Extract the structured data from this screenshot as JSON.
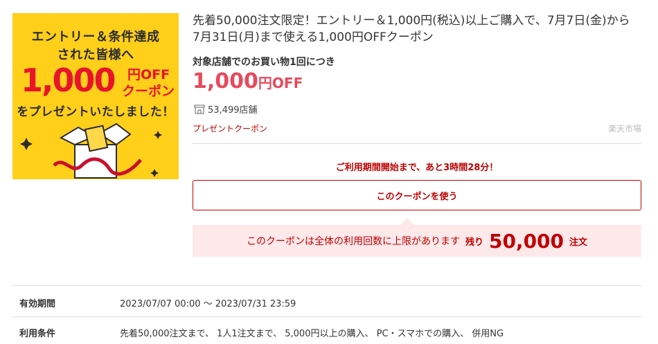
{
  "banner": {
    "line1": "エントリー＆条件達成",
    "line2": "された皆様へ",
    "amount": "1,000",
    "off_line1": "円OFF",
    "off_line2": "クーポン",
    "line5": "をプレゼントいたしました！"
  },
  "coupon": {
    "title": "先着50,000注文限定！エントリー＆1,000円(税込)以上ご購入で、7月7日(金)から7月31日(月)まで使える1,000円OFFクーポン",
    "subtitle": "対象店舗でのお買い物1回につき",
    "discount_value": "1,000",
    "discount_unit": "円OFF",
    "store_icon": "store-icon",
    "store_count": "53,499店舗",
    "coupon_type": "プレゼントクーポン",
    "provider": "楽天市場"
  },
  "countdown": "ご利用期間開始まで、あと3時間28分！",
  "use_button_label": "このクーポンを使う",
  "limit": {
    "text": "このクーポンは全体の利用回数に上限があります",
    "remaining_label": "残り",
    "remaining_count": "50,000",
    "remaining_unit": "注文"
  },
  "details": [
    {
      "label": "有効期間",
      "value": "2023/07/07 00:00 ～ 2023/07/31 23:59"
    },
    {
      "label": "利用条件",
      "value": "先着50,000注文まで、 1人1注文まで、 5,000円以上の購入、 PC・スマホでの購入、 併用NG"
    }
  ],
  "colors": {
    "accent": "#bf0000",
    "price": "#e64a5d",
    "banner_bg": "#ffcf1a",
    "limit_bg": "#fde8ea"
  }
}
